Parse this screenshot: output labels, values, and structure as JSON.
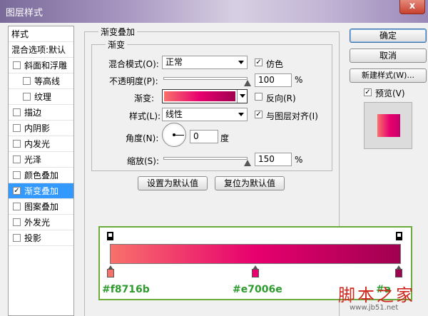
{
  "window": {
    "title": "图层样式",
    "close_label": "x"
  },
  "sidebar": {
    "items": [
      {
        "label": "样式",
        "checkbox": false,
        "checked": false
      },
      {
        "label": "混合选项:默认",
        "checkbox": false,
        "checked": false
      },
      {
        "label": "斜面和浮雕",
        "checkbox": true,
        "checked": false
      },
      {
        "label": "等高线",
        "checkbox": true,
        "checked": false,
        "sub": true
      },
      {
        "label": "纹理",
        "checkbox": true,
        "checked": false,
        "sub": true
      },
      {
        "label": "描边",
        "checkbox": true,
        "checked": false
      },
      {
        "label": "内阴影",
        "checkbox": true,
        "checked": false
      },
      {
        "label": "内发光",
        "checkbox": true,
        "checked": false
      },
      {
        "label": "光泽",
        "checkbox": true,
        "checked": false
      },
      {
        "label": "颜色叠加",
        "checkbox": true,
        "checked": false
      },
      {
        "label": "渐变叠加",
        "checkbox": true,
        "checked": true,
        "selected": true
      },
      {
        "label": "图案叠加",
        "checkbox": true,
        "checked": false
      },
      {
        "label": "外发光",
        "checkbox": true,
        "checked": false
      },
      {
        "label": "投影",
        "checkbox": true,
        "checked": false
      }
    ],
    "check_mark": "✓"
  },
  "panel": {
    "outer_title": "渐变叠加",
    "inner_title": "渐变",
    "blend_mode": {
      "label": "混合模式(O):",
      "value": "正常"
    },
    "dither": {
      "label": "仿色",
      "checked": true
    },
    "opacity": {
      "label": "不透明度(P):",
      "value": "100",
      "unit": "%",
      "level": 1.0
    },
    "gradient": {
      "label": "渐变:"
    },
    "reverse": {
      "label": "反向(R)",
      "checked": false
    },
    "style": {
      "label": "样式(L):",
      "value": "线性"
    },
    "align_layer": {
      "label": "与图层对齐(I)",
      "checked": true
    },
    "angle": {
      "label": "角度(N):",
      "value": "0",
      "unit": "度"
    },
    "scale": {
      "label": "缩放(S):",
      "value": "150",
      "unit": "%",
      "level": 1.0
    },
    "set_default_label": "设置为默认值",
    "reset_default_label": "复位为默认值"
  },
  "actions": {
    "ok_label": "确定",
    "cancel_label": "取消",
    "new_style_label": "新建样式(W)...",
    "preview": {
      "label": "预览(V)",
      "checked": true
    }
  },
  "gradient_editor": {
    "stops": [
      {
        "color": "#f8716b",
        "label": "#f8716b"
      },
      {
        "color": "#e7006e",
        "label": "#e7006e"
      },
      {
        "color": "#a00050",
        "label": "#a"
      }
    ]
  },
  "watermark": {
    "text": "脚本之家",
    "url": "www.jb51.net"
  },
  "colors": {
    "accent": "#3399ff",
    "annotation": "#2e9b2e",
    "editor_border": "#6aab3a"
  }
}
